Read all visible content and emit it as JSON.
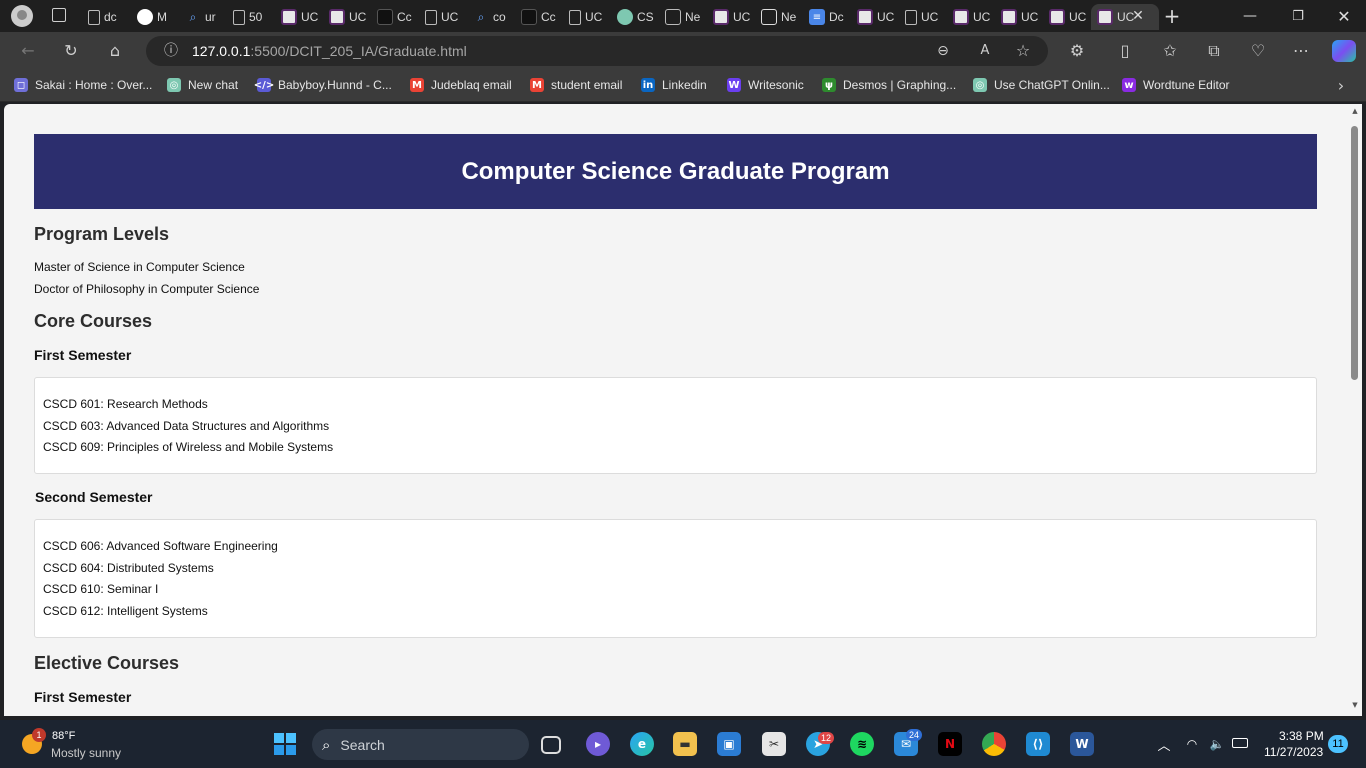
{
  "browser": {
    "tabs": [
      {
        "label": "dc",
        "icon": "document-icon"
      },
      {
        "label": "M",
        "icon": "github-icon"
      },
      {
        "label": "ur",
        "icon": "search-icon"
      },
      {
        "label": "50",
        "icon": "document-icon"
      },
      {
        "label": "UC",
        "icon": "ug-logo-icon"
      },
      {
        "label": "UC",
        "icon": "ug-logo-icon"
      },
      {
        "label": "Cc",
        "icon": "dark-square-icon"
      },
      {
        "label": "UC",
        "icon": "document-icon"
      },
      {
        "label": "co",
        "icon": "search-icon"
      },
      {
        "label": "Cc",
        "icon": "dark-square-icon"
      },
      {
        "label": "UC",
        "icon": "document-icon"
      },
      {
        "label": "CS",
        "icon": "chatgpt-icon"
      },
      {
        "label": "Ne",
        "icon": "box-icon"
      },
      {
        "label": "UC",
        "icon": "ug-logo-icon"
      },
      {
        "label": "Ne",
        "icon": "calendar-icon"
      },
      {
        "label": "Dc",
        "icon": "google-docs-icon"
      },
      {
        "label": "UC",
        "icon": "ug-logo-icon"
      },
      {
        "label": "UC",
        "icon": "document-icon"
      },
      {
        "label": "UC",
        "icon": "ug-logo-icon"
      },
      {
        "label": "UC",
        "icon": "ug-logo-icon"
      },
      {
        "label": "UC",
        "icon": "ug-logo-icon"
      },
      {
        "label": "UC",
        "icon": "ug-logo-icon",
        "active": true
      }
    ],
    "url_host": "127.0.0.1",
    "url_path": ":5500/DCIT_205_IA/Graduate.html",
    "bookmarks": [
      {
        "label": "Sakai : Home : Over...",
        "icon": "sakai-icon",
        "color": "#6f6fd8"
      },
      {
        "label": "New chat",
        "icon": "chatgpt-icon",
        "color": "#7ec8b1"
      },
      {
        "label": "Babyboy.Hunnd - C...",
        "icon": "code-icon",
        "color": "#5b5bd6"
      },
      {
        "label": "Judeblaq email",
        "icon": "gmail-icon",
        "color": "#ea4335"
      },
      {
        "label": "student email",
        "icon": "gmail-icon",
        "color": "#ea4335"
      },
      {
        "label": "Linkedin",
        "icon": "linkedin-icon",
        "color": "#0a66c2"
      },
      {
        "label": "Writesonic",
        "icon": "writesonic-icon",
        "color": "#6b3ff0"
      },
      {
        "label": "Desmos | Graphing...",
        "icon": "desmos-icon",
        "color": "#2e8b2e"
      },
      {
        "label": "Use ChatGPT Onlin...",
        "icon": "chatgpt-icon",
        "color": "#7ec8b1"
      },
      {
        "label": "Wordtune Editor",
        "icon": "wordtune-icon",
        "color": "#8a2be2"
      }
    ]
  },
  "page": {
    "banner_title": "Computer Science Graduate Program",
    "program_levels_heading": "Program Levels",
    "program_levels": [
      "Master of Science in Computer Science",
      "Doctor of Philosophy in Computer Science"
    ],
    "core_heading": "Core Courses",
    "core_first_sem_heading": "First Semester",
    "core_first_sem": [
      "CSCD 601: Research Methods",
      "CSCD 603: Advanced Data Structures and Algorithms",
      "CSCD 609: Principles of Wireless and Mobile Systems"
    ],
    "core_second_sem_heading": "Second Semester",
    "core_second_sem": [
      "CSCD 606: Advanced Software Engineering",
      "CSCD 604: Distributed Systems",
      "CSCD 610: Seminar I",
      "CSCD 612: Intelligent Systems"
    ],
    "elective_heading": "Elective Courses",
    "elective_first_sem_heading": "First Semester"
  },
  "taskbar": {
    "weather_temp": "88°F",
    "weather_desc": "Mostly sunny",
    "weather_badge": "1",
    "search_placeholder": "Search",
    "telegram_badge": "12",
    "mail_badge": "24",
    "time": "3:38 PM",
    "date": "11/27/2023",
    "notification_count": "11"
  },
  "colors": {
    "banner_bg": "#2c2e6e",
    "page_bg": "#f4f4f4",
    "browser_chrome": "#3b3b3b",
    "taskbar_bg": "#1c2430"
  }
}
